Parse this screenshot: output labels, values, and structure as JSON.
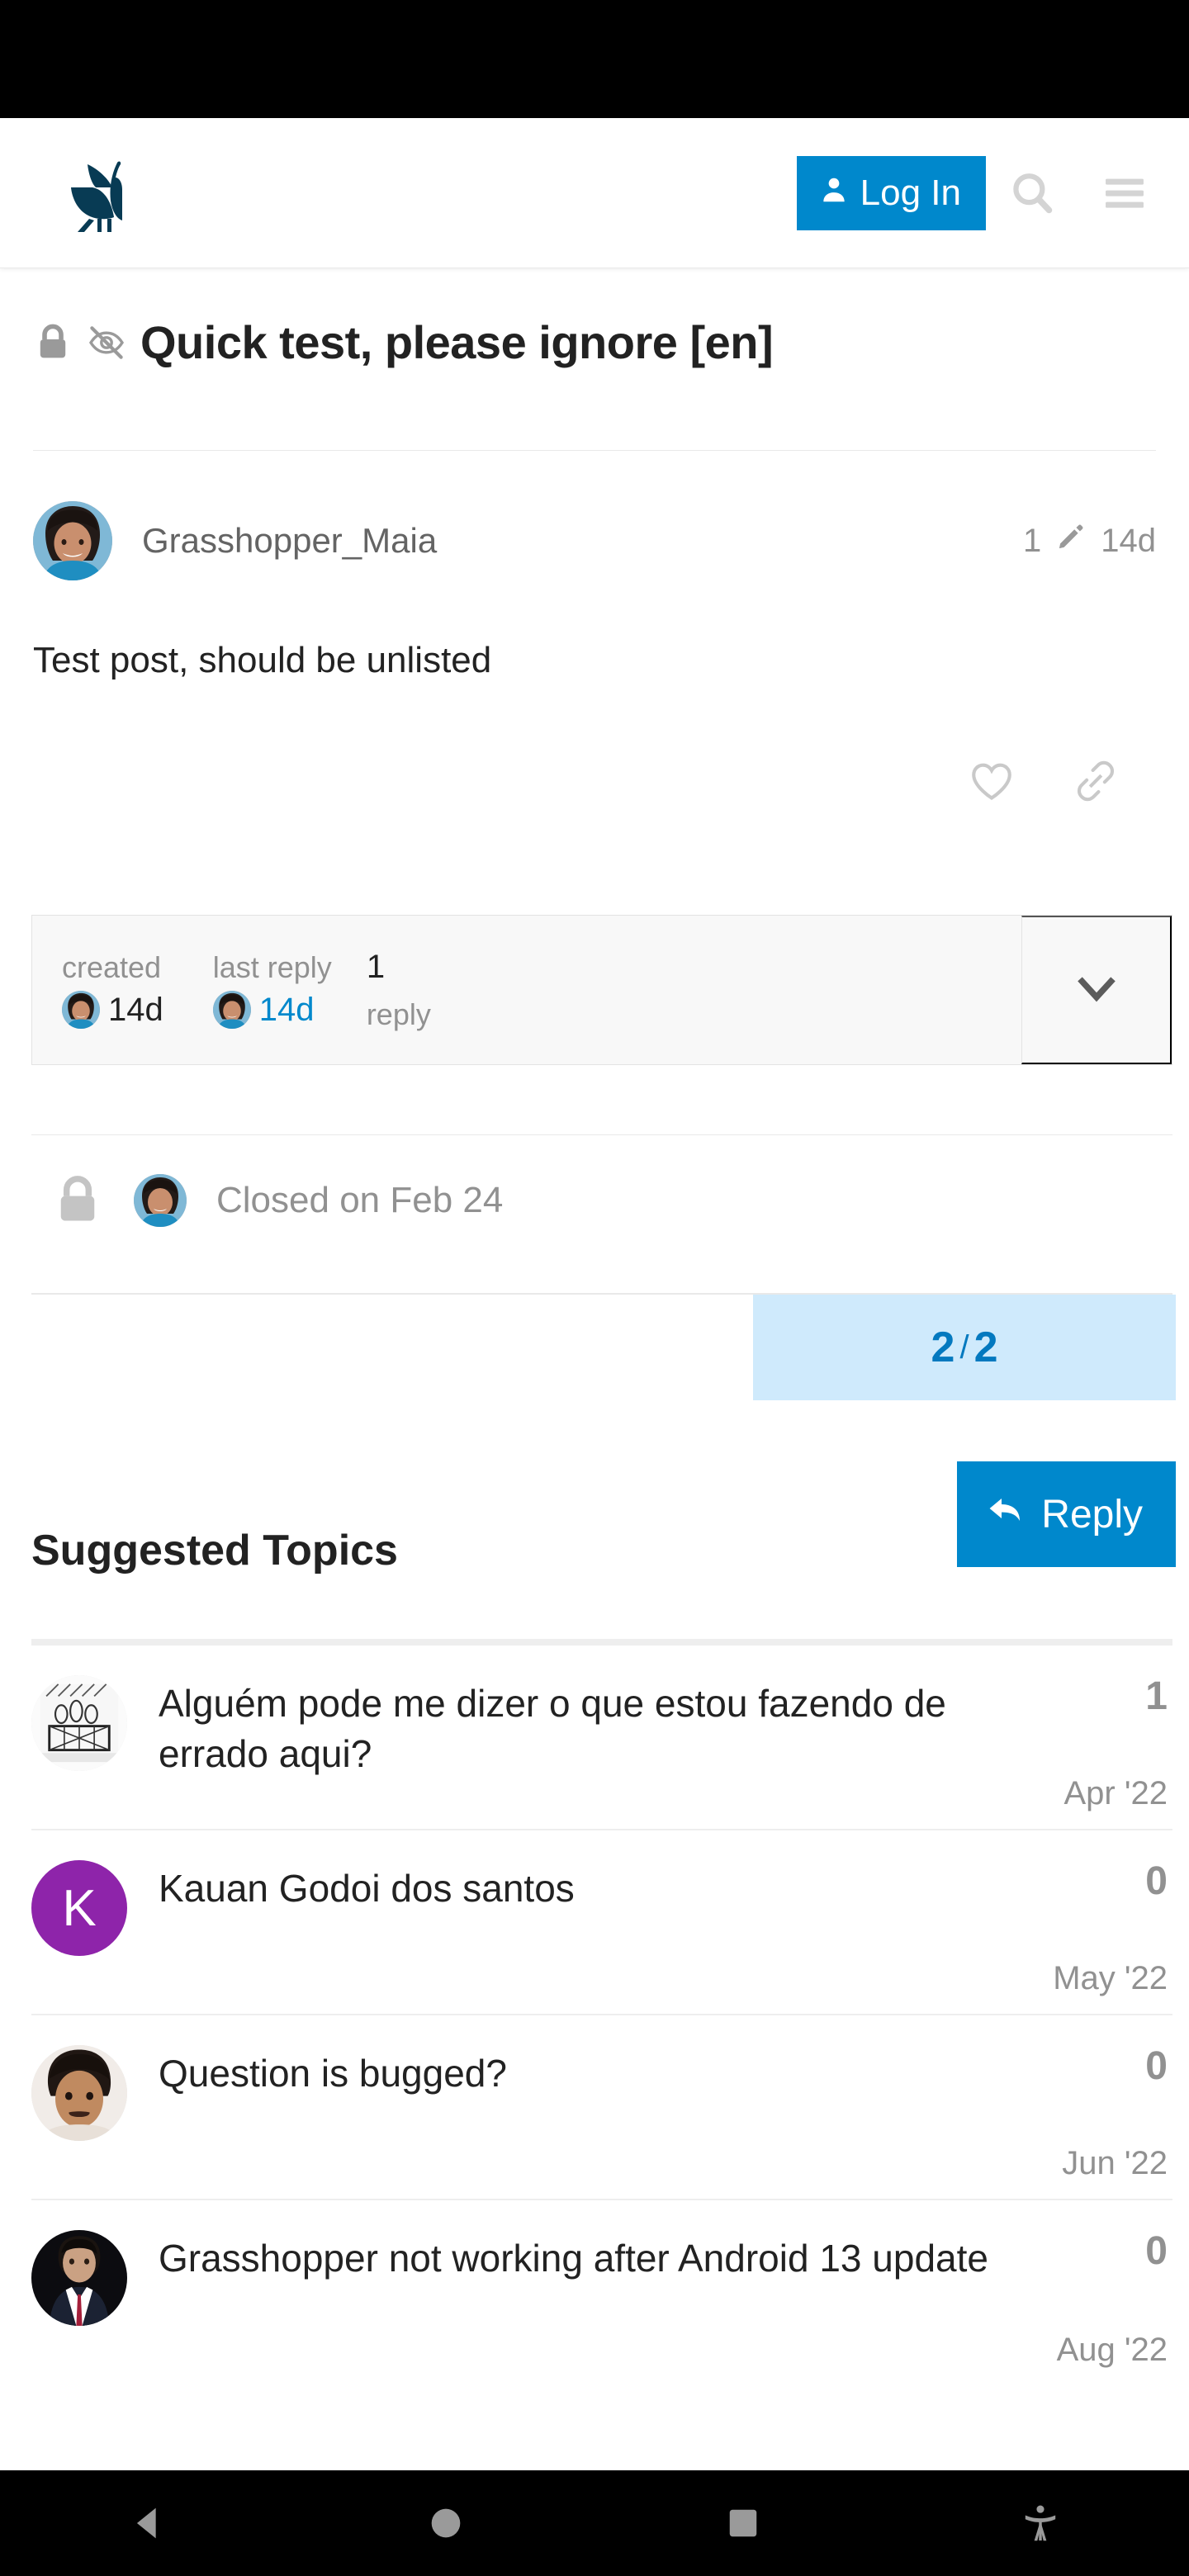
{
  "header": {
    "logo_name": "grasshopper-logo",
    "login_label": "Log In",
    "search_icon": "search-icon",
    "menu_icon": "hamburger-menu-icon",
    "accent_color": "#0088cc"
  },
  "topic": {
    "title": "Quick test, please ignore [en]",
    "lock_icon": "lock-icon",
    "unlisted_icon": "eye-slash-icon"
  },
  "post": {
    "author": "Grasshopper_Maia",
    "edit_count": "1",
    "edit_icon": "pencil-icon",
    "relative_date": "14d",
    "body": "Test post, should be unlisted",
    "like_icon": "heart-icon",
    "share_icon": "link-icon"
  },
  "topic_map": {
    "created_label": "created",
    "created_value": "14d",
    "last_reply_label": "last reply",
    "last_reply_value": "14d",
    "reply_count": "1",
    "reply_word": "reply",
    "expand_icon": "chevron-down-icon"
  },
  "closed_notice": {
    "lock_icon": "lock-icon",
    "text": "Closed on Feb 24"
  },
  "progress": {
    "current": "2",
    "separator": "/",
    "total": "2"
  },
  "reply_button": {
    "label": "Reply",
    "icon": "reply-arrow-icon"
  },
  "suggested": {
    "heading": "Suggested Topics",
    "topics": [
      {
        "title": "Alguém pode me dizer o que estou fazendo de errado aqui?",
        "count": "1",
        "date": "Apr '22",
        "avatar_type": "image",
        "avatar_color": "#f2f2f2",
        "avatar_letter": ""
      },
      {
        "title": "Kauan Godoi dos santos",
        "count": "0",
        "date": "May '22",
        "avatar_type": "letter",
        "avatar_color": "#8e24aa",
        "avatar_letter": "K"
      },
      {
        "title": "Question is bugged?",
        "count": "0",
        "date": "Jun '22",
        "avatar_type": "image",
        "avatar_color": "#d9b79c",
        "avatar_letter": ""
      },
      {
        "title": "Grasshopper not working after Android 13 update",
        "count": "0",
        "date": "Aug '22",
        "avatar_type": "image",
        "avatar_color": "#1c1c22",
        "avatar_letter": ""
      }
    ]
  },
  "nav_bar": {
    "back_icon": "back-triangle-icon",
    "home_icon": "home-circle-icon",
    "recents_icon": "recents-square-icon",
    "accessibility_icon": "accessibility-icon"
  }
}
